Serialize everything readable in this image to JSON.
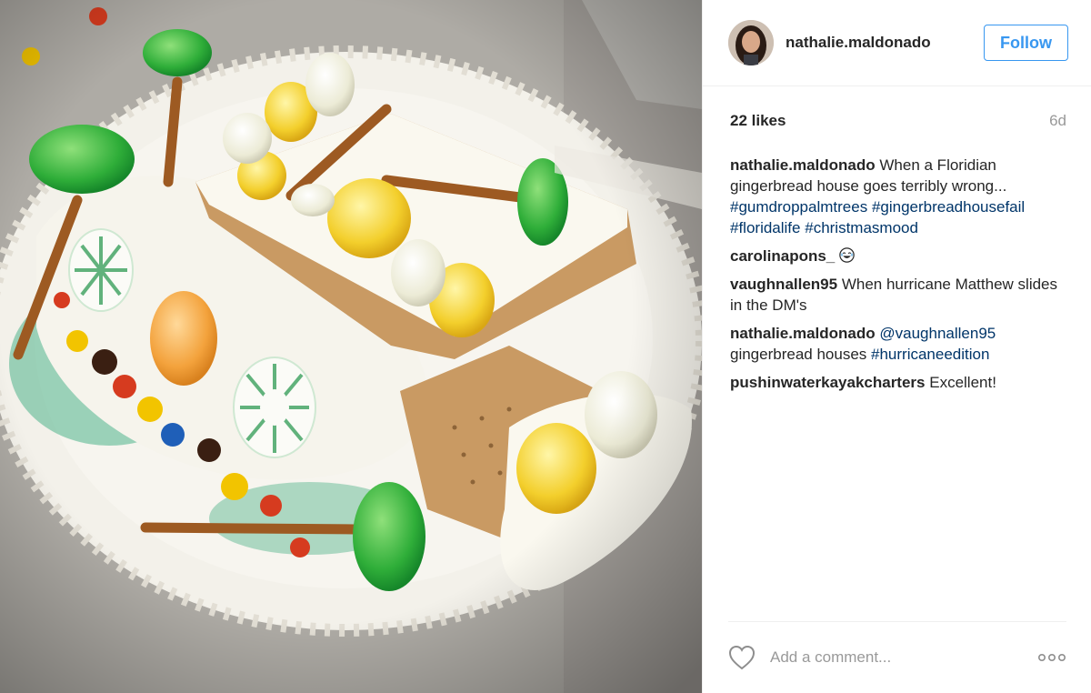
{
  "post": {
    "photo_icon": "gingerbread-house-photo",
    "username": "nathalie.maldonado",
    "follow_label": "Follow",
    "likes": "22 likes",
    "age": "6d",
    "colors": {
      "accent": "#3897f0",
      "hashtag": "#003569",
      "muted": "#999999"
    }
  },
  "caption": {
    "author": "nathalie.maldonado",
    "text": "When a Floridian gingerbread house goes terribly wrong...",
    "hashtags": [
      "#gumdroppalmtrees",
      "#gingerbreadhousefail",
      "#floridalife",
      "#christmasmood"
    ]
  },
  "comments": [
    {
      "author": "carolinapons_",
      "text": "",
      "emoji": "laughing-emoji"
    },
    {
      "author": "vaughnallen95",
      "text": "When hurricane Matthew slides in the DM's"
    },
    {
      "author": "nathalie.maldonado",
      "mention": "@vaughnallen95",
      "text": "gingerbread houses",
      "hashtag": "#hurricaneedition"
    },
    {
      "author": "pushinwaterkayakcharters",
      "text": "Excellent!"
    }
  ],
  "footer": {
    "comment_placeholder": "Add a comment...",
    "like_icon": "heart-icon",
    "more_icon": "more-options-icon"
  }
}
